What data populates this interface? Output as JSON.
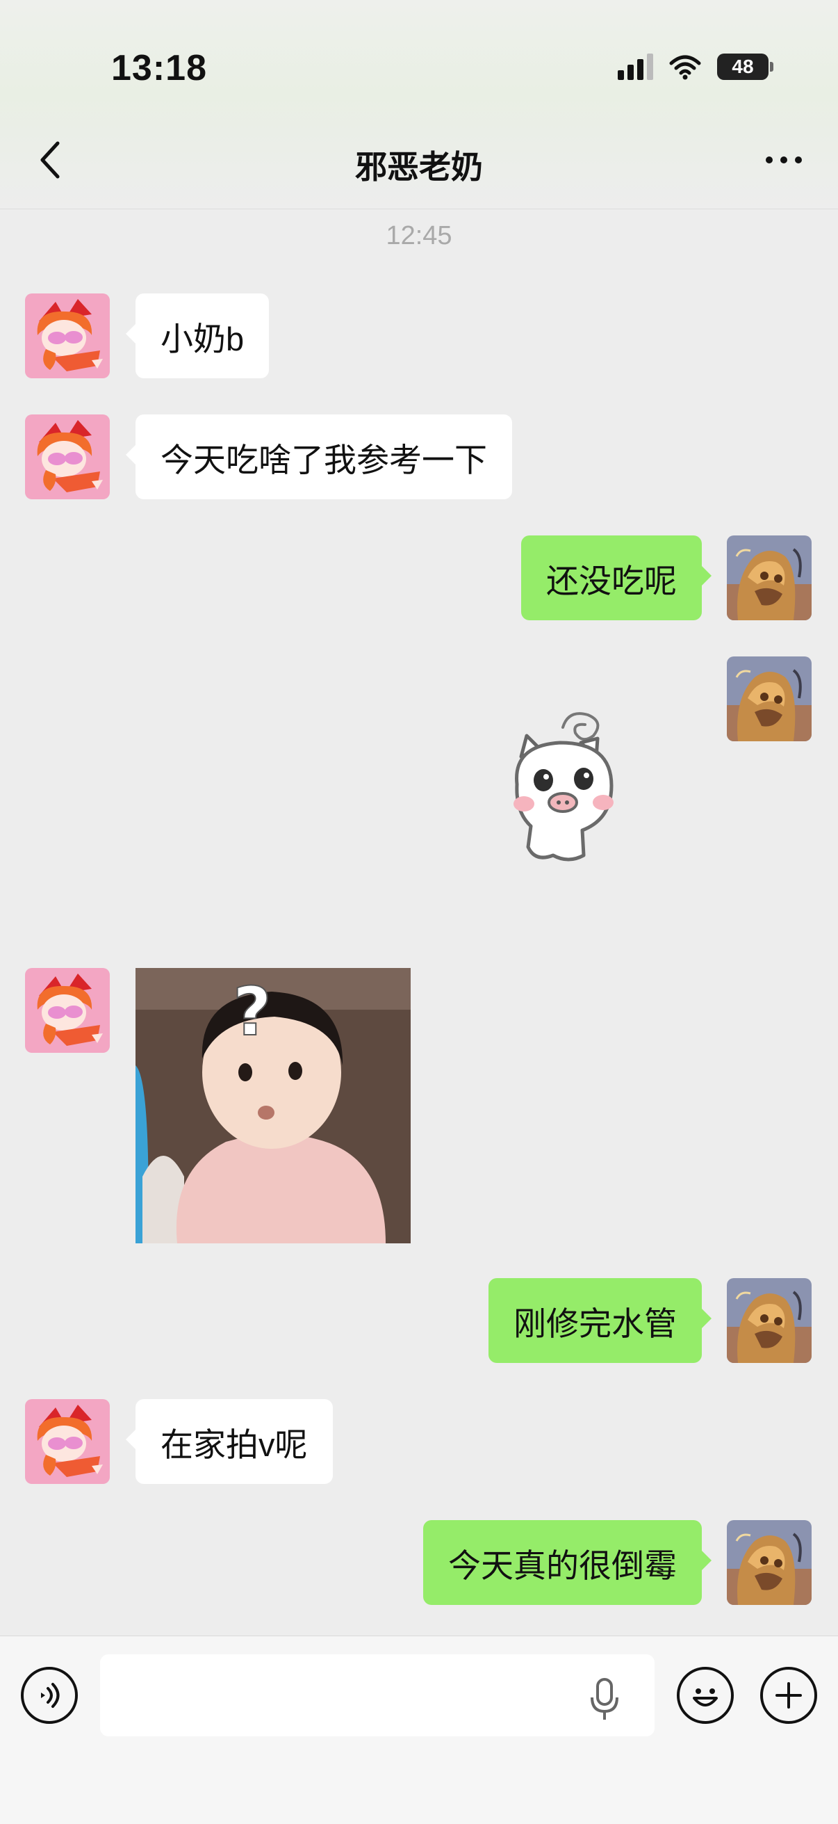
{
  "status_bar": {
    "time": "13:18",
    "battery": "48"
  },
  "header": {
    "title": "邪恶老奶"
  },
  "chat": {
    "timestamp": "12:45",
    "messages": [
      {
        "direction": "in",
        "type": "text",
        "text": "小奶b"
      },
      {
        "direction": "in",
        "type": "text",
        "text": "今天吃啥了我参考一下"
      },
      {
        "direction": "out",
        "type": "text",
        "text": "还没吃呢"
      },
      {
        "direction": "out",
        "type": "sticker",
        "sticker": "piglet-dizzy-sticker"
      },
      {
        "direction": "in",
        "type": "sticker",
        "sticker": "baby-question-mark-sticker",
        "overlay_text": "?"
      },
      {
        "direction": "out",
        "type": "text",
        "text": "刚修完水管"
      },
      {
        "direction": "in",
        "type": "text",
        "text": "在家拍v呢"
      },
      {
        "direction": "out",
        "type": "text",
        "text": "今天真的很倒霉"
      }
    ]
  },
  "input_bar": {
    "value": "",
    "icons": [
      "voice-mode-icon",
      "microphone-icon",
      "emoji-icon",
      "plus-icon"
    ]
  },
  "colors": {
    "outgoing_bubble": "#95ec69",
    "incoming_bubble": "#ffffff",
    "background": "#ededed"
  }
}
